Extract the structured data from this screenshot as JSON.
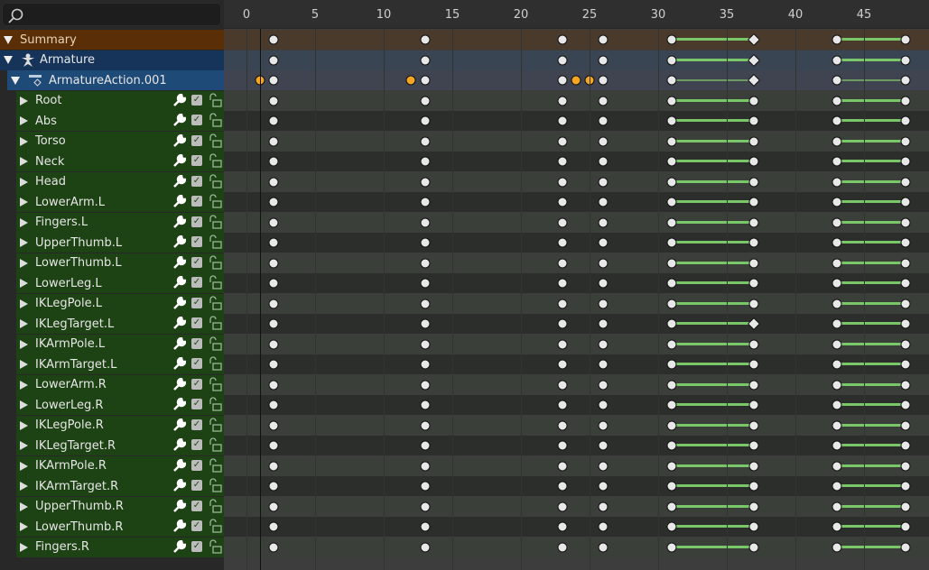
{
  "search": {
    "placeholder": "",
    "icon": "search-icon"
  },
  "ruler": {
    "ticks": [
      0,
      5,
      10,
      15,
      20,
      25,
      30,
      35,
      40,
      45
    ]
  },
  "current_frame": 1,
  "colors": {
    "summary": "#5a2f07",
    "armature": "#16335a",
    "action": "#1e4a78",
    "channel": "#1d4213",
    "key": "#e8e8e8",
    "selected_key": "#f5a623",
    "interpolation": "#7ac76a"
  },
  "summary": {
    "label": "Summary"
  },
  "armature": {
    "label": "Armature",
    "icon": "armature-icon"
  },
  "action": {
    "label": "ArmatureAction.001",
    "icon": "action-icon"
  },
  "channels": [
    "Root",
    "Abs",
    "Torso",
    "Neck",
    "Head",
    "LowerArm.L",
    "Fingers.L",
    "UpperThumb.L",
    "LowerThumb.L",
    "LowerLeg.L",
    "IKLegPole.L",
    "IKLegTarget.L",
    "IKArmPole.L",
    "IKArmTarget.L",
    "LowerArm.R",
    "LowerLeg.R",
    "IKLegPole.R",
    "IKLegTarget.R",
    "IKArmPole.R",
    "IKArmTarget.R",
    "UpperThumb.R",
    "LowerThumb.R",
    "Fingers.R"
  ],
  "keyframes": {
    "frames": [
      2,
      13,
      23,
      26,
      31,
      37,
      43,
      48
    ],
    "selected_in_action": [
      1,
      12,
      24,
      25
    ],
    "interpolated_spans": [
      [
        31,
        37
      ],
      [
        43,
        48
      ]
    ],
    "breakdown_frame": 37,
    "breakdown_rows": [
      "summary",
      "armature",
      "action",
      "IKLegTarget.L"
    ]
  }
}
